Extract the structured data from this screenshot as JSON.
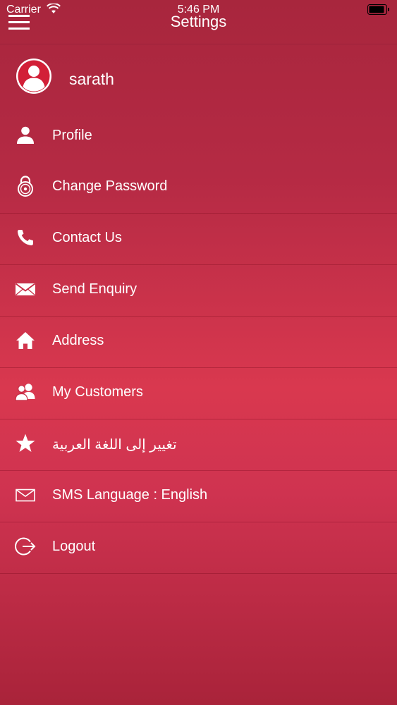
{
  "status": {
    "carrier": "Carrier",
    "time": "5:46 PM"
  },
  "header": {
    "title": "Settings"
  },
  "user": {
    "name": "sarath"
  },
  "menu": [
    {
      "label": "Profile",
      "icon": "person-icon"
    },
    {
      "label": "Change Password",
      "icon": "lock-icon"
    },
    {
      "label": "Contact Us",
      "icon": "phone-icon"
    },
    {
      "label": "Send Enquiry",
      "icon": "envelope-icon"
    },
    {
      "label": "Address",
      "icon": "home-icon"
    },
    {
      "label": "My Customers",
      "icon": "users-icon"
    },
    {
      "label": "تغيير إلى اللغة العربية",
      "icon": "star-icon"
    },
    {
      "label": "SMS Language : English",
      "icon": "envelope-outline-icon"
    },
    {
      "label": "Logout",
      "icon": "logout-icon"
    }
  ]
}
